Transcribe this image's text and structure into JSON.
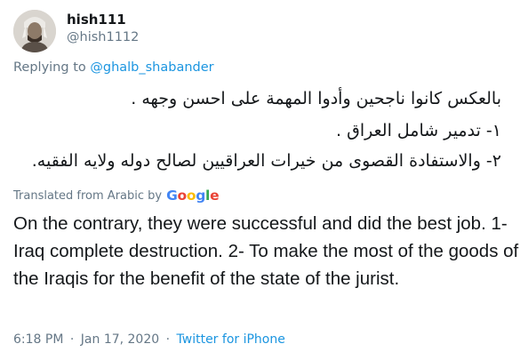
{
  "author": {
    "display_name": "hish111",
    "handle": "@hish1112",
    "avatar_icon": "user-avatar-photo"
  },
  "reply": {
    "prefix": "Replying to",
    "target": "@ghalb_shabander"
  },
  "tweet": {
    "arabic_lines": [
      "بالعكس كانوا ناجحين وأدوا المهمة على احسن وجهه .",
      "١- تدمير شامل العراق .",
      "٢- والاستفادة القصوى من خيرات العراقيين لصالح دوله ولايه الفقيه."
    ],
    "translated_label": "Translated from Arabic by",
    "translator": {
      "letters": [
        "G",
        "o",
        "o",
        "g",
        "l",
        "e"
      ],
      "colors": [
        "#4285F4",
        "#EA4335",
        "#FBBC05",
        "#4285F4",
        "#34A853",
        "#EA4335"
      ]
    },
    "translation": "On the contrary, they were successful and did the best job. 1- Iraq complete destruction. 2- To make the most of the goods of the Iraqis for the benefit of the state of the jurist."
  },
  "meta": {
    "time": "6:18 PM",
    "separator1": "·",
    "date": "Jan 17, 2020",
    "separator2": "·",
    "source": "Twitter for iPhone"
  },
  "colors": {
    "text_primary": "#14171a",
    "text_secondary": "#657786",
    "link": "#1b95e0",
    "background": "#ffffff"
  }
}
